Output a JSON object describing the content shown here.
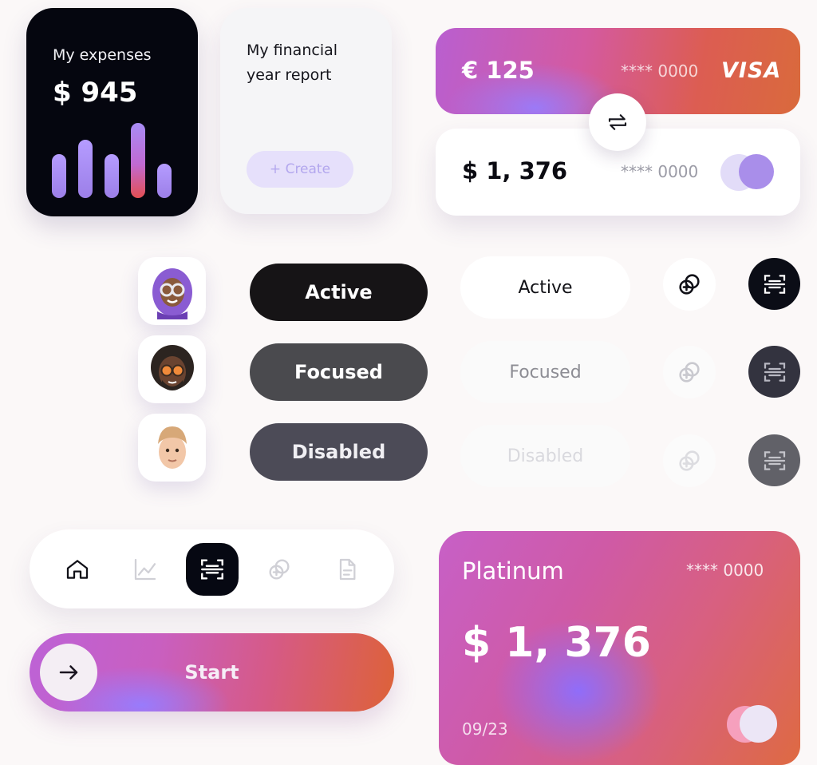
{
  "expenses": {
    "label": "My expenses",
    "amount": "$ 945",
    "bar_levels": [
      0.58,
      0.78,
      0.58,
      1.0,
      0.46
    ],
    "highlight_index": 3
  },
  "report": {
    "title": "My financial year report",
    "create_label": "+ Create"
  },
  "cards": {
    "euro": {
      "amount": "€ 125",
      "masked": "**** 0000",
      "brand": "VISA"
    },
    "usd": {
      "amount": "$ 1, 376",
      "masked": "**** 0000"
    },
    "swap_icon": "swap-arrows-icon"
  },
  "avatars": [
    {
      "name": "avatar-1",
      "skin": "#8a5a3c",
      "hair": "#8a5cd2"
    },
    {
      "name": "avatar-2",
      "skin": "#6a4330",
      "hair": "#2c2420"
    },
    {
      "name": "avatar-3",
      "skin": "#f2c7a8",
      "hair": "#d7a878"
    }
  ],
  "buttons": {
    "filled": [
      "Active",
      "Focused",
      "Disabled"
    ],
    "outline": [
      "Active",
      "Focused",
      "Disabled"
    ]
  },
  "tabbar": {
    "icons": [
      "home-icon",
      "chart-icon",
      "scan-icon",
      "link-icon",
      "document-icon"
    ],
    "active": 2
  },
  "start": {
    "label": "Start"
  },
  "platinum": {
    "name": "Platinum",
    "masked": "**** 0000",
    "amount": "$ 1, 376",
    "expiry": "09/23"
  },
  "colors": {
    "dark": "#05060f",
    "accent_purple": "#a98eea",
    "gradient_pink": "#d45aa0",
    "gradient_orange": "#d96a3c"
  }
}
